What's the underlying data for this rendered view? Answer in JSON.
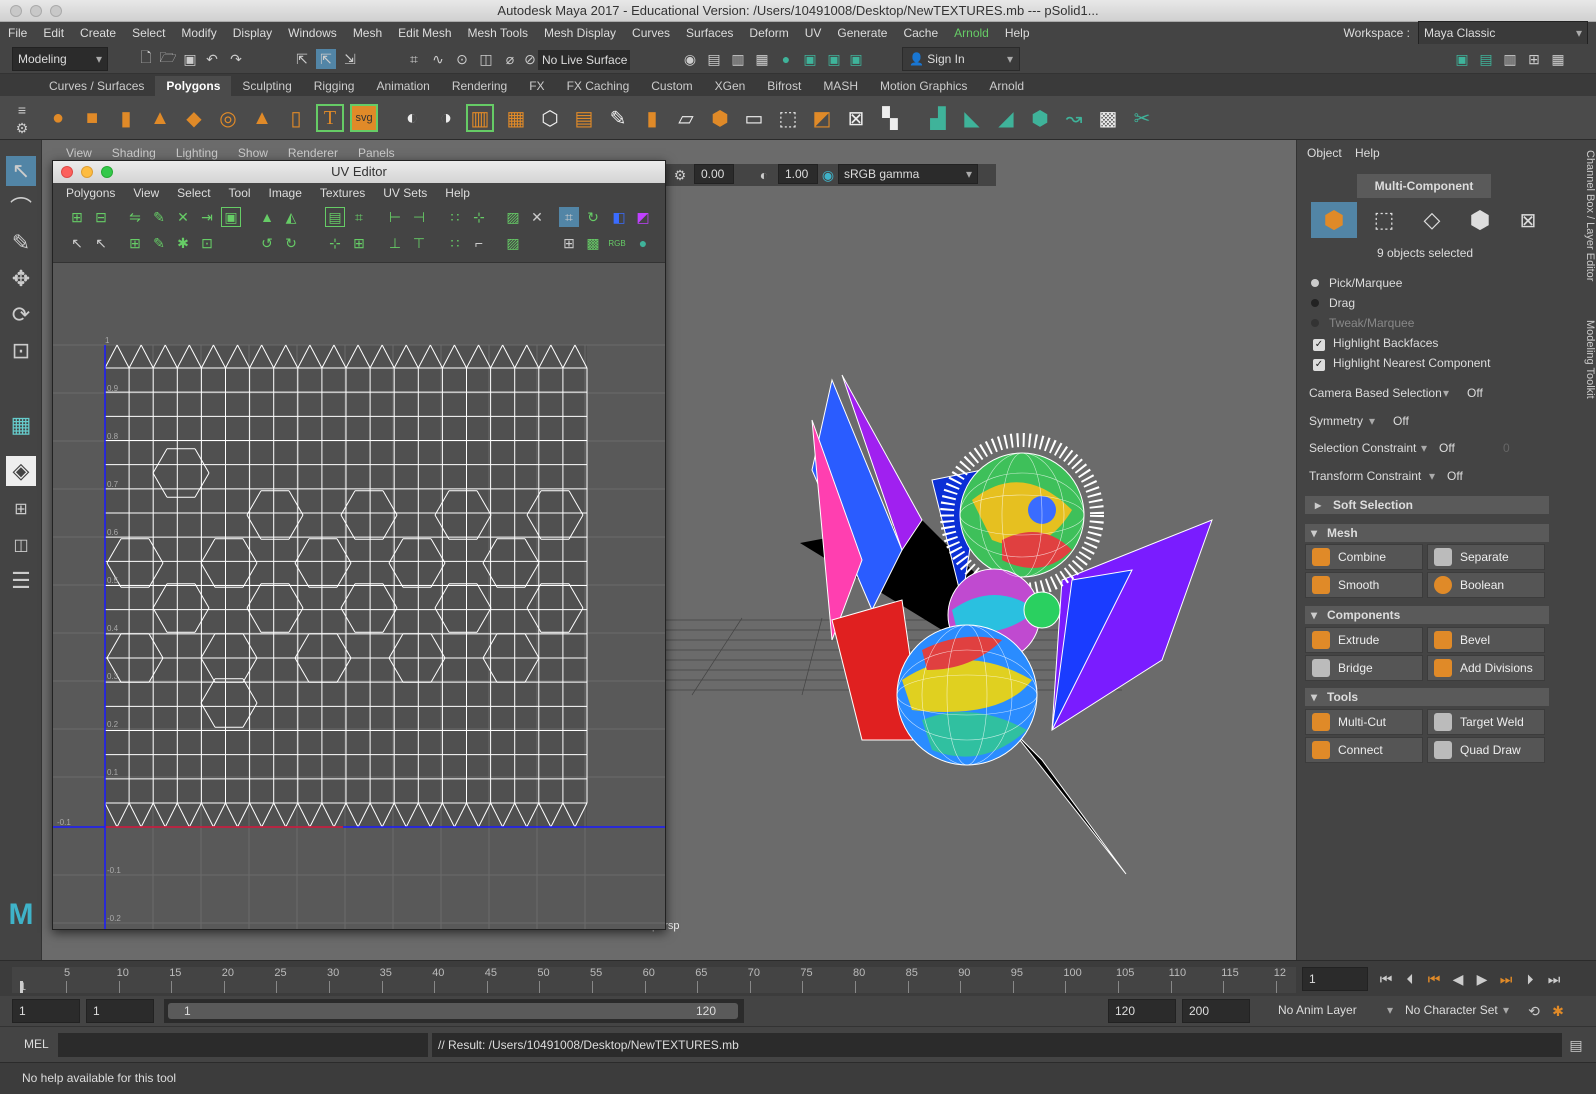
{
  "window": {
    "title": "Autodesk Maya 2017 - Educational Version: /Users/10491008/Desktop/NewTEXTURES.mb  ---   pSolid1..."
  },
  "menubar": [
    "File",
    "Edit",
    "Create",
    "Select",
    "Modify",
    "Display",
    "Windows",
    "Mesh",
    "Edit Mesh",
    "Mesh Tools",
    "Mesh Display",
    "Curves",
    "Surfaces",
    "Deform",
    "UV",
    "Generate",
    "Cache",
    "Arnold",
    "Help"
  ],
  "workspace": {
    "label": "Workspace :",
    "value": "Maya Classic"
  },
  "statusline": {
    "mode": "Modeling",
    "live_surface": "No Live Surface",
    "sign_in": "Sign In"
  },
  "shelf_tabs": [
    "Curves / Surfaces",
    "Polygons",
    "Sculpting",
    "Rigging",
    "Animation",
    "Rendering",
    "FX",
    "FX Caching",
    "Custom",
    "XGen",
    "Bifrost",
    "MASH",
    "Motion Graphics",
    "Arnold"
  ],
  "shelf_active": "Polygons",
  "shelf_text_icons": {
    "text_tool": "T",
    "svg_tool": "svg"
  },
  "viewport": {
    "menu": [
      "View",
      "Shading",
      "Lighting",
      "Show",
      "Renderer",
      "Panels"
    ],
    "exposure": "0.00",
    "gamma": "1.00",
    "colorspace": "sRGB gamma",
    "camera": "persp"
  },
  "uv_editor": {
    "title": "UV Editor",
    "menu": [
      "Polygons",
      "View",
      "Select",
      "Tool",
      "Image",
      "Textures",
      "UV Sets",
      "Help"
    ],
    "axis_labels": [
      "1",
      "0.9",
      "0.8",
      "0.7",
      "0.6",
      "0.5",
      "0.4",
      "0.3",
      "0.2",
      "0.1",
      "-0.1",
      "-0.1",
      "-0.2"
    ],
    "rgb_label": "RGB"
  },
  "right_panel": {
    "menu": [
      "Object",
      "Help"
    ],
    "multi_component": "Multi-Component",
    "selected": "9 objects selected",
    "pick_marquee": "Pick/Marquee",
    "drag": "Drag",
    "tweak_marquee": "Tweak/Marquee",
    "highlight_backfaces": "Highlight Backfaces",
    "highlight_nearest": "Highlight Nearest Component",
    "camera_based": {
      "label": "Camera Based Selection",
      "value": "Off"
    },
    "symmetry": {
      "label": "Symmetry",
      "value": "Off"
    },
    "selection_constraint": {
      "label": "Selection Constraint",
      "value": "Off",
      "num": "0"
    },
    "transform_constraint": {
      "label": "Transform Constraint",
      "value": "Off"
    },
    "soft_selection": "Soft Selection",
    "mesh": {
      "title": "Mesh",
      "buttons": [
        "Combine",
        "Separate",
        "Smooth",
        "Boolean"
      ]
    },
    "components": {
      "title": "Components",
      "buttons": [
        "Extrude",
        "Bevel",
        "Bridge",
        "Add Divisions"
      ]
    },
    "tools": {
      "title": "Tools",
      "buttons": [
        "Multi-Cut",
        "Target Weld",
        "Connect",
        "Quad Draw"
      ]
    },
    "side_tabs": [
      "Channel Box / Layer Editor",
      "Modeling Toolkit"
    ]
  },
  "timeline": {
    "ticks": [
      "1",
      "5",
      "10",
      "15",
      "20",
      "25",
      "30",
      "35",
      "40",
      "45",
      "50",
      "55",
      "60",
      "65",
      "70",
      "75",
      "80",
      "85",
      "90",
      "95",
      "100",
      "105",
      "110",
      "115",
      "12"
    ],
    "current_frame": "1"
  },
  "range": {
    "start": "1",
    "anim_start": "1",
    "slider_start": "1",
    "slider_end": "120",
    "end": "120",
    "anim_end": "200",
    "anim_layer": "No Anim Layer",
    "character_set": "No Character Set"
  },
  "command": {
    "label": "MEL",
    "result": "// Result: /Users/10491008/Desktop/NewTEXTURES.mb"
  },
  "help_line": "No help available for this tool"
}
